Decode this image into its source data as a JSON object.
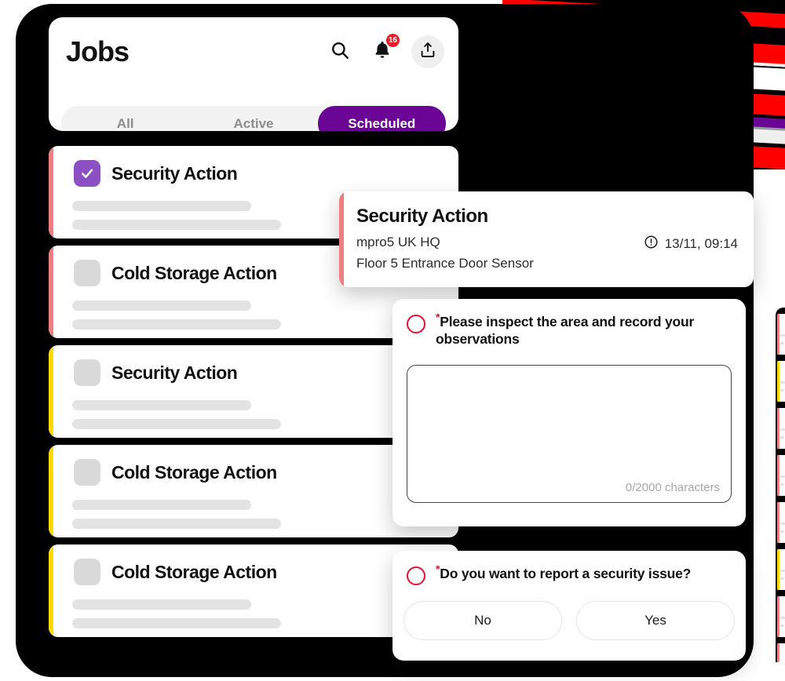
{
  "header": {
    "title": "Jobs",
    "icons": {
      "search": "search-icon",
      "bell": "bell-icon",
      "upload": "upload-icon"
    },
    "notification_count": "16",
    "tabs": [
      {
        "label": "All",
        "active": false
      },
      {
        "label": "Active",
        "active": false
      },
      {
        "label": "Scheduled",
        "active": true
      }
    ]
  },
  "job_list": [
    {
      "title": "Security Action",
      "checked": true,
      "accent": "#ef7f7f"
    },
    {
      "title": "Cold Storage Action",
      "checked": false,
      "accent": "#ef7f7f"
    },
    {
      "title": "Security Action",
      "checked": false,
      "accent": "#ffd900"
    },
    {
      "title": "Cold Storage Action",
      "checked": false,
      "accent": "#ffd900"
    },
    {
      "title": "Cold Storage Action",
      "checked": false,
      "accent": "#ffd900"
    }
  ],
  "detail": {
    "title": "Security Action",
    "site": "mpro5 UK HQ",
    "asset": "Floor 5 Entrance Door Sensor",
    "timestamp": "13/11, 09:14",
    "alert_icon": "alert-circle-icon",
    "accent": "#ef7f7f"
  },
  "question_text": {
    "required_marker": "*",
    "label": "Please inspect the area and record your observations",
    "value": "",
    "char_counter": "0/2000 characters",
    "max_chars": 2000
  },
  "question_choice": {
    "required_marker": "*",
    "label": "Do you want to report a security issue?",
    "options": [
      {
        "label": "No"
      },
      {
        "label": "Yes"
      }
    ]
  },
  "colors": {
    "brand_purple": "#6a0596",
    "checkbox_purple": "#8c4fc4",
    "accent_pink": "#ef7f7f",
    "accent_yellow": "#ffd900",
    "required_red": "#e8112d",
    "badge_red": "#ea1d2c",
    "frame_black": "#000000"
  },
  "artifact": {
    "description": "diagonal-stripe-glitch-band",
    "stripe_colors": [
      "#ff0000",
      "#ffffff",
      "#000000",
      "#6a0596",
      "#efefef"
    ]
  }
}
